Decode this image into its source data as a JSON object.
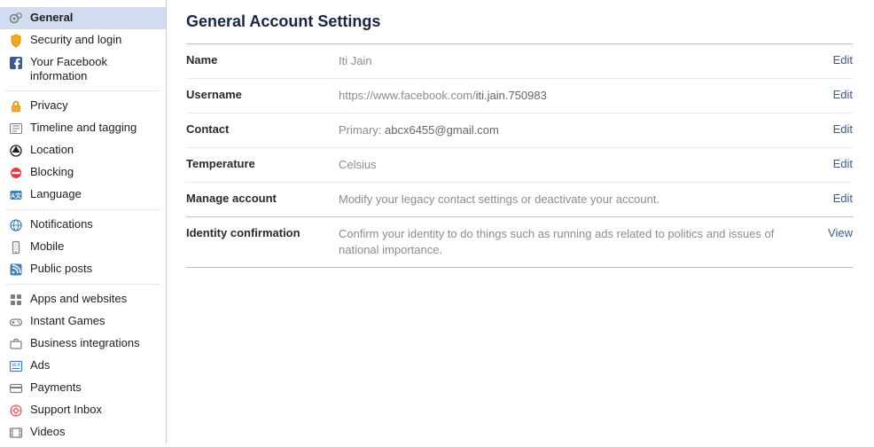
{
  "page": {
    "title": "General Account Settings"
  },
  "sidebar": {
    "groups": [
      {
        "items": [
          {
            "key": "general",
            "label": "General",
            "active": true
          },
          {
            "key": "security",
            "label": "Security and login"
          },
          {
            "key": "fbinfo",
            "label": "Your Facebook information"
          }
        ]
      },
      {
        "items": [
          {
            "key": "privacy",
            "label": "Privacy"
          },
          {
            "key": "timeline",
            "label": "Timeline and tagging"
          },
          {
            "key": "location",
            "label": "Location"
          },
          {
            "key": "blocking",
            "label": "Blocking"
          },
          {
            "key": "language",
            "label": "Language"
          }
        ]
      },
      {
        "items": [
          {
            "key": "notifications",
            "label": "Notifications"
          },
          {
            "key": "mobile",
            "label": "Mobile"
          },
          {
            "key": "publicposts",
            "label": "Public posts"
          }
        ]
      },
      {
        "items": [
          {
            "key": "apps",
            "label": "Apps and websites"
          },
          {
            "key": "games",
            "label": "Instant Games"
          },
          {
            "key": "bizint",
            "label": "Business integrations"
          },
          {
            "key": "ads",
            "label": "Ads"
          },
          {
            "key": "payments",
            "label": "Payments"
          },
          {
            "key": "support",
            "label": "Support Inbox"
          },
          {
            "key": "videos",
            "label": "Videos"
          }
        ]
      }
    ]
  },
  "rows": {
    "name": {
      "label": "Name",
      "value": "Iti Jain",
      "action": "Edit"
    },
    "username": {
      "label": "Username",
      "prefix": "https://www.facebook.com/",
      "value": "iti.jain.750983",
      "action": "Edit"
    },
    "contact": {
      "label": "Contact",
      "prefix": "Primary: ",
      "value": "abcx6455@gmail.com",
      "action": "Edit"
    },
    "temperature": {
      "label": "Temperature",
      "value": "Celsius",
      "action": "Edit"
    },
    "manage": {
      "label": "Manage account",
      "value": "Modify your legacy contact settings or deactivate your account.",
      "action": "Edit"
    },
    "identity": {
      "label": "Identity confirmation",
      "value": "Confirm your identity to do things such as running ads related to politics and issues of national importance.",
      "action": "View"
    }
  }
}
